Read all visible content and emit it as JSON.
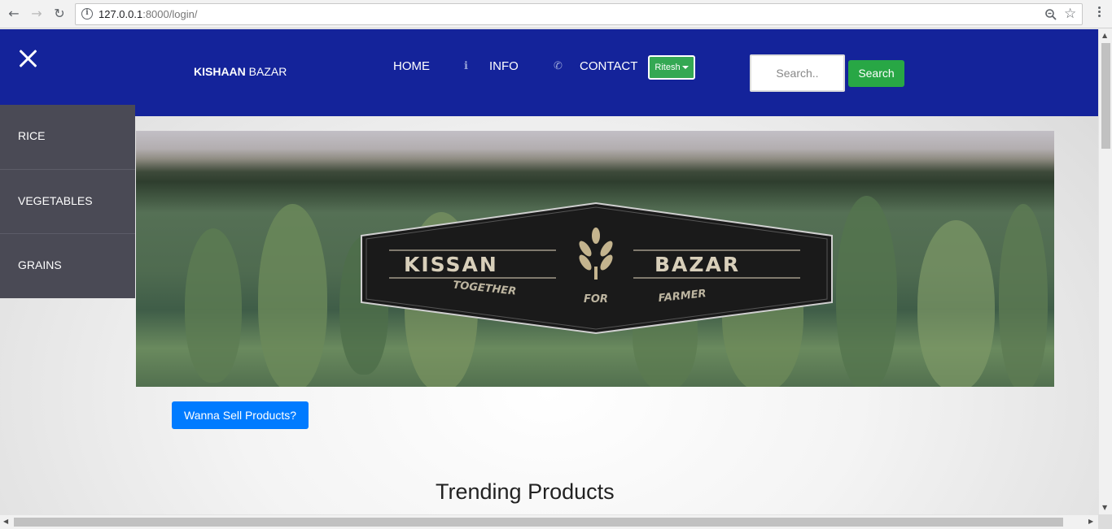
{
  "browser": {
    "url_host": "127.0.0.1",
    "url_path": ":8000/login/"
  },
  "header": {
    "brand_bold": "KISHAAN",
    "brand_rest": " BAZAR",
    "nav": [
      {
        "label": "HOME"
      },
      {
        "label": "INFO",
        "icon": "info-icon"
      },
      {
        "label": "CONTACT",
        "icon": "phone-icon"
      }
    ],
    "user_label": "Ritesh",
    "search_placeholder": "Search..",
    "search_button": "Search",
    "color": "#14239a"
  },
  "sidebar": {
    "items": [
      {
        "label": "RICE"
      },
      {
        "label": "VEGETABLES"
      },
      {
        "label": "GRAINS"
      }
    ]
  },
  "banner": {
    "logo_left": "KISSAN",
    "logo_right": "BAZAR",
    "tagline": [
      "TOGETHER",
      "FOR",
      "FARMER"
    ]
  },
  "main": {
    "sell_button": "Wanna Sell Products?",
    "section_title": "Trending Products"
  },
  "colors": {
    "accent_blue": "#007bff",
    "search_green": "#28a745",
    "sidebar_bg": "#4a4a55"
  }
}
